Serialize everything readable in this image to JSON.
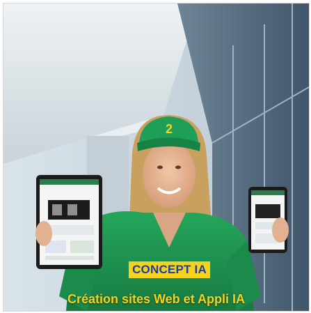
{
  "cap": {
    "number": "2"
  },
  "badge": {
    "text": "CONCEPT IA"
  },
  "caption": {
    "text": "Création sites Web et Appli IA"
  },
  "colors": {
    "brand_yellow": "#f5d21d",
    "brand_green": "#1e9e57",
    "brand_blue": "#1a3fa3"
  }
}
